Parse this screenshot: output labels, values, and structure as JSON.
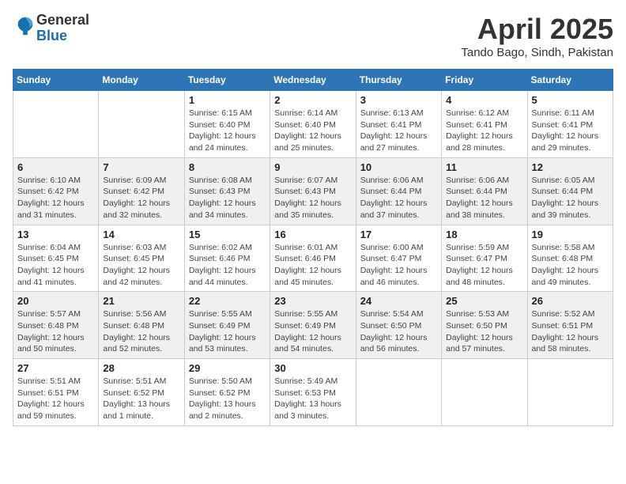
{
  "logo": {
    "line1": "General",
    "line2": "Blue"
  },
  "title": "April 2025",
  "location": "Tando Bago, Sindh, Pakistan",
  "weekdays": [
    "Sunday",
    "Monday",
    "Tuesday",
    "Wednesday",
    "Thursday",
    "Friday",
    "Saturday"
  ],
  "weeks": [
    [
      null,
      null,
      {
        "day": "1",
        "sunrise": "6:15 AM",
        "sunset": "6:40 PM",
        "daylight": "12 hours and 24 minutes."
      },
      {
        "day": "2",
        "sunrise": "6:14 AM",
        "sunset": "6:40 PM",
        "daylight": "12 hours and 25 minutes."
      },
      {
        "day": "3",
        "sunrise": "6:13 AM",
        "sunset": "6:41 PM",
        "daylight": "12 hours and 27 minutes."
      },
      {
        "day": "4",
        "sunrise": "6:12 AM",
        "sunset": "6:41 PM",
        "daylight": "12 hours and 28 minutes."
      },
      {
        "day": "5",
        "sunrise": "6:11 AM",
        "sunset": "6:41 PM",
        "daylight": "12 hours and 29 minutes."
      }
    ],
    [
      {
        "day": "6",
        "sunrise": "6:10 AM",
        "sunset": "6:42 PM",
        "daylight": "12 hours and 31 minutes."
      },
      {
        "day": "7",
        "sunrise": "6:09 AM",
        "sunset": "6:42 PM",
        "daylight": "12 hours and 32 minutes."
      },
      {
        "day": "8",
        "sunrise": "6:08 AM",
        "sunset": "6:43 PM",
        "daylight": "12 hours and 34 minutes."
      },
      {
        "day": "9",
        "sunrise": "6:07 AM",
        "sunset": "6:43 PM",
        "daylight": "12 hours and 35 minutes."
      },
      {
        "day": "10",
        "sunrise": "6:06 AM",
        "sunset": "6:44 PM",
        "daylight": "12 hours and 37 minutes."
      },
      {
        "day": "11",
        "sunrise": "6:06 AM",
        "sunset": "6:44 PM",
        "daylight": "12 hours and 38 minutes."
      },
      {
        "day": "12",
        "sunrise": "6:05 AM",
        "sunset": "6:44 PM",
        "daylight": "12 hours and 39 minutes."
      }
    ],
    [
      {
        "day": "13",
        "sunrise": "6:04 AM",
        "sunset": "6:45 PM",
        "daylight": "12 hours and 41 minutes."
      },
      {
        "day": "14",
        "sunrise": "6:03 AM",
        "sunset": "6:45 PM",
        "daylight": "12 hours and 42 minutes."
      },
      {
        "day": "15",
        "sunrise": "6:02 AM",
        "sunset": "6:46 PM",
        "daylight": "12 hours and 44 minutes."
      },
      {
        "day": "16",
        "sunrise": "6:01 AM",
        "sunset": "6:46 PM",
        "daylight": "12 hours and 45 minutes."
      },
      {
        "day": "17",
        "sunrise": "6:00 AM",
        "sunset": "6:47 PM",
        "daylight": "12 hours and 46 minutes."
      },
      {
        "day": "18",
        "sunrise": "5:59 AM",
        "sunset": "6:47 PM",
        "daylight": "12 hours and 48 minutes."
      },
      {
        "day": "19",
        "sunrise": "5:58 AM",
        "sunset": "6:48 PM",
        "daylight": "12 hours and 49 minutes."
      }
    ],
    [
      {
        "day": "20",
        "sunrise": "5:57 AM",
        "sunset": "6:48 PM",
        "daylight": "12 hours and 50 minutes."
      },
      {
        "day": "21",
        "sunrise": "5:56 AM",
        "sunset": "6:48 PM",
        "daylight": "12 hours and 52 minutes."
      },
      {
        "day": "22",
        "sunrise": "5:55 AM",
        "sunset": "6:49 PM",
        "daylight": "12 hours and 53 minutes."
      },
      {
        "day": "23",
        "sunrise": "5:55 AM",
        "sunset": "6:49 PM",
        "daylight": "12 hours and 54 minutes."
      },
      {
        "day": "24",
        "sunrise": "5:54 AM",
        "sunset": "6:50 PM",
        "daylight": "12 hours and 56 minutes."
      },
      {
        "day": "25",
        "sunrise": "5:53 AM",
        "sunset": "6:50 PM",
        "daylight": "12 hours and 57 minutes."
      },
      {
        "day": "26",
        "sunrise": "5:52 AM",
        "sunset": "6:51 PM",
        "daylight": "12 hours and 58 minutes."
      }
    ],
    [
      {
        "day": "27",
        "sunrise": "5:51 AM",
        "sunset": "6:51 PM",
        "daylight": "12 hours and 59 minutes."
      },
      {
        "day": "28",
        "sunrise": "5:51 AM",
        "sunset": "6:52 PM",
        "daylight": "13 hours and 1 minute."
      },
      {
        "day": "29",
        "sunrise": "5:50 AM",
        "sunset": "6:52 PM",
        "daylight": "13 hours and 2 minutes."
      },
      {
        "day": "30",
        "sunrise": "5:49 AM",
        "sunset": "6:53 PM",
        "daylight": "13 hours and 3 minutes."
      },
      null,
      null,
      null
    ]
  ]
}
